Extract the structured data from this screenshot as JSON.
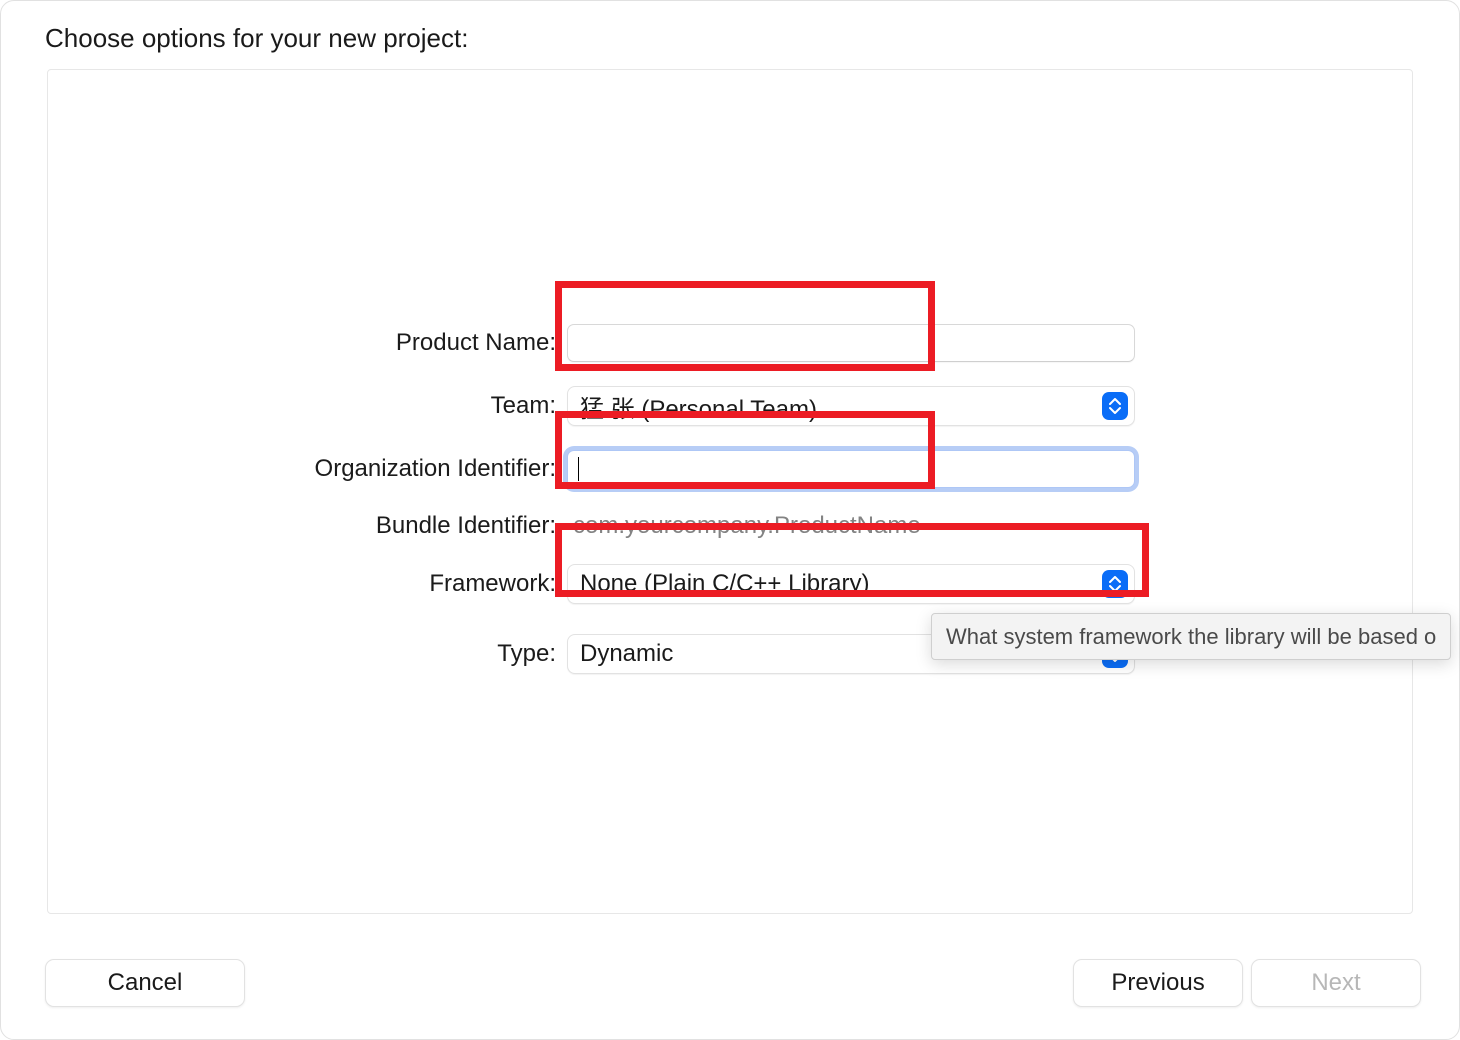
{
  "title": "Choose options for your new project:",
  "rows": {
    "product_name": {
      "label": "Product Name:",
      "value": ""
    },
    "team": {
      "label": "Team:",
      "value": "猛 张 (Personal Team)"
    },
    "org_id": {
      "label": "Organization Identifier:",
      "value": ""
    },
    "bundle_id": {
      "label": "Bundle Identifier:",
      "value": "com.yourcompany.ProductName"
    },
    "framework": {
      "label": "Framework:",
      "value": "None (Plain C/C++ Library)"
    },
    "type": {
      "label": "Type:",
      "value": "Dynamic"
    }
  },
  "tooltip": "What system framework the library will be based o",
  "buttons": {
    "cancel": "Cancel",
    "previous": "Previous",
    "next": "Next"
  },
  "colors": {
    "accent": "#0a6df7",
    "highlight": "#ec1c24"
  }
}
